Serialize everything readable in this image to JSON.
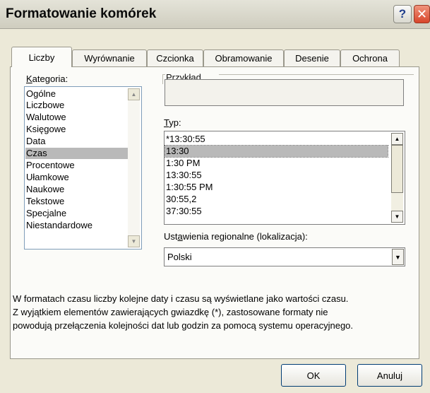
{
  "window": {
    "title": "Formatowanie komórek",
    "help_glyph": "?",
    "close_glyph": "✕"
  },
  "tabs": [
    {
      "label": "Liczby",
      "active": true
    },
    {
      "label": "Wyrównanie"
    },
    {
      "label": "Czcionka"
    },
    {
      "label": "Obramowanie"
    },
    {
      "label": "Desenie"
    },
    {
      "label": "Ochrona"
    }
  ],
  "category": {
    "label": "Kategoria:",
    "items": [
      "Ogólne",
      "Liczbowe",
      "Walutowe",
      "Księgowe",
      "Data",
      "Czas",
      "Procentowe",
      "Ułamkowe",
      "Naukowe",
      "Tekstowe",
      "Specjalne",
      "Niestandardowe"
    ],
    "selected": "Czas"
  },
  "sample": {
    "label": "Przykład",
    "value": ""
  },
  "type": {
    "label": "Typ:",
    "items": [
      "*13:30:55",
      "13:30",
      "1:30 PM",
      "13:30:55",
      "1:30:55 PM",
      "30:55,2",
      "37:30:55"
    ],
    "selected": "13:30"
  },
  "locale": {
    "label": "Ustawienia regionalne (lokalizacja):",
    "value": "Polski"
  },
  "description": [
    "W formatach czasu liczby kolejne daty i czasu są wyświetlane jako wartości czasu.",
    "Z wyjątkiem elementów zawierających gwiazdkę (*), zastosowane formaty nie",
    "powodują przełączenia kolejności dat lub godzin za pomocą systemu operacyjnego."
  ],
  "buttons": {
    "ok": "OK",
    "cancel": "Anuluj"
  },
  "icons": {
    "up": "▲",
    "down": "▼"
  }
}
